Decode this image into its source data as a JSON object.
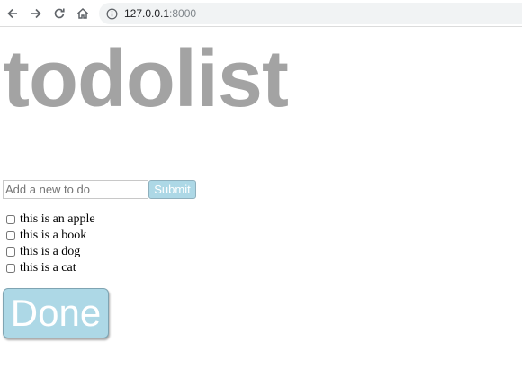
{
  "browser": {
    "url_host": "127.0.0.1",
    "url_port": ":8000"
  },
  "page": {
    "title": "todolist",
    "input_placeholder": "Add a new to do",
    "input_value": "",
    "submit_label": "Submit",
    "todos": [
      {
        "text": "this is an apple",
        "checked": false
      },
      {
        "text": "this is a book",
        "checked": false
      },
      {
        "text": "this is a dog",
        "checked": false
      },
      {
        "text": "this is a cat",
        "checked": false
      }
    ],
    "done_label": "Done"
  },
  "colors": {
    "title": "#a3a3a3",
    "button_bg": "#add8e6",
    "button_text": "#ffffff"
  }
}
